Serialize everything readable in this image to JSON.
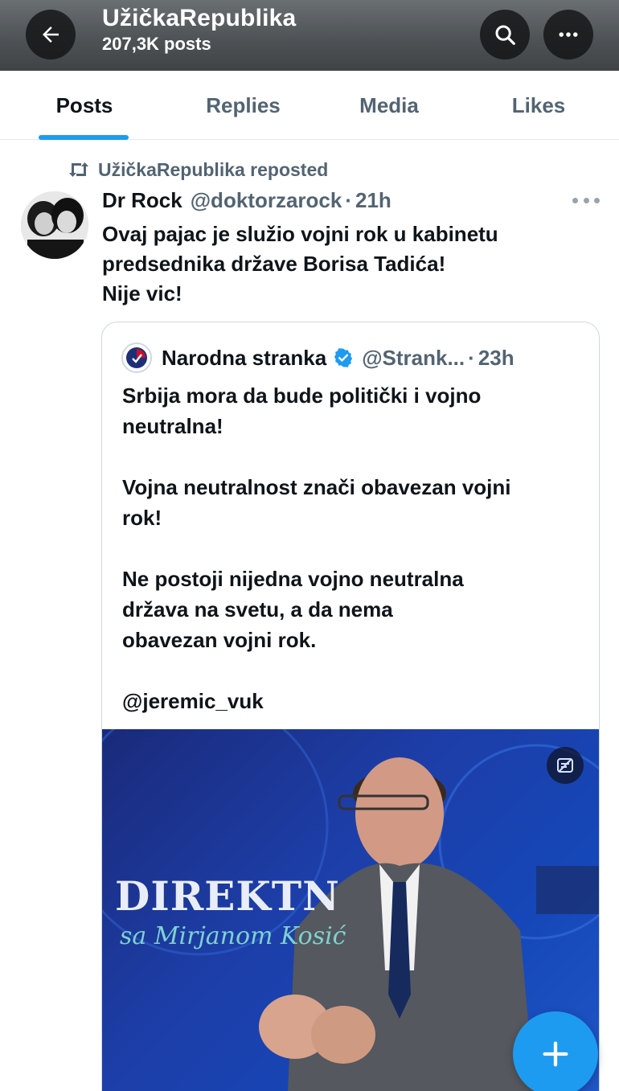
{
  "header": {
    "title": "UžičkaRepublika",
    "post_count": "207,3K posts",
    "back_icon": "arrow-left-icon",
    "search_icon": "search-icon",
    "more_icon": "more-horizontal-icon"
  },
  "tabs": [
    {
      "label": "Posts",
      "active": true
    },
    {
      "label": "Replies",
      "active": false
    },
    {
      "label": "Media",
      "active": false
    },
    {
      "label": "Likes",
      "active": false
    }
  ],
  "post": {
    "repost_label": "UžičkaRepublika reposted",
    "author_name": "Dr Rock",
    "author_handle": "@doktorzarock",
    "separator": "·",
    "time": "21h",
    "text": "Ovaj pajac je služio vojni rok u kabinetu\npredsednika države Borisa Tadića!\nNije vic!",
    "quote": {
      "name": "Narodna stranka",
      "handle": "@Strank...",
      "separator": "·",
      "time": "23h",
      "verified": true,
      "paragraphs": [
        "Srbija mora da bude politički i vojno\nneutralna!",
        "Vojna neutralnost znači obavezan vojni\nrok!",
        "Ne postoji nijedna vojno neutralna\ndržava na svetu, a da nema\nobavezan vojni rok.",
        "@jeremic_vuk"
      ],
      "media": {
        "brand_text": "DIREKTN",
        "script_text": "sa Mirjanom Kosić",
        "badge_icon": "alt-text-badge-icon"
      }
    }
  },
  "fab": {
    "icon": "plus-icon"
  },
  "colors": {
    "accent": "#1d9bf0",
    "text_primary": "#0f1419",
    "text_secondary": "#536471"
  }
}
